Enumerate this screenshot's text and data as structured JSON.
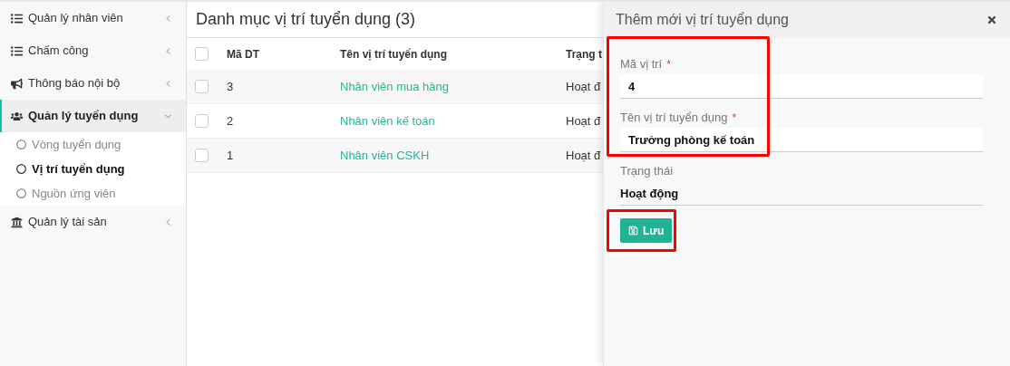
{
  "sidebar": {
    "items": [
      {
        "label": "Quản lý nhân viên",
        "kind": "list",
        "expanded": false,
        "selected": false
      },
      {
        "label": "Chấm công",
        "kind": "list",
        "expanded": false,
        "selected": false
      },
      {
        "label": "Thông báo nội bộ",
        "kind": "bullhorn",
        "expanded": false,
        "selected": false
      },
      {
        "label": "Quản lý tuyển dụng",
        "kind": "users",
        "expanded": true,
        "selected": true,
        "children": [
          {
            "label": "Vòng tuyển dụng",
            "selected": false
          },
          {
            "label": "Vị trí tuyển dụng",
            "selected": true
          },
          {
            "label": "Nguồn ứng viên",
            "selected": false
          }
        ]
      },
      {
        "label": "Quản lý tài sản",
        "kind": "bank",
        "expanded": false,
        "selected": false
      }
    ]
  },
  "list": {
    "title": "Danh mục vị trí tuyển dụng (3)",
    "all_checked": false,
    "columns": [
      "Mã DT",
      "Tên vị trí tuyển dụng",
      "Trạng t"
    ],
    "rows": [
      {
        "checked": false,
        "cells": [
          "3",
          "Nhân viên mua hàng",
          "Hoạt đ"
        ]
      },
      {
        "checked": false,
        "cells": [
          "2",
          "Nhân viên kế toán",
          "Hoạt đ"
        ]
      },
      {
        "checked": false,
        "cells": [
          "1",
          "Nhân viên CSKH",
          "Hoạt đ"
        ]
      }
    ]
  },
  "panel": {
    "title": "Thêm mới vị trí tuyển dụng",
    "fields": [
      {
        "label": "Mã vị trí",
        "required": true,
        "value": "4"
      },
      {
        "label": "Tên vị trí tuyển dụng",
        "required": true,
        "value": "Trưởng phòng kế toán"
      },
      {
        "label": "Trạng thái",
        "required": false,
        "value": "Hoạt động"
      }
    ],
    "required_mark": "*",
    "save_button": "Lưu"
  }
}
